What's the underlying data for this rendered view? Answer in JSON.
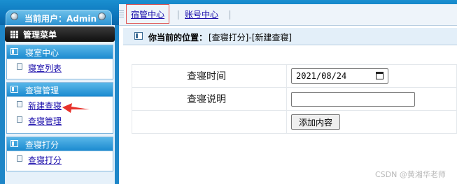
{
  "header": {
    "current_user": "当前用户：Admin"
  },
  "top_nav": {
    "tabs": [
      {
        "label": "宿管中心"
      },
      {
        "label": "账号中心"
      }
    ]
  },
  "sidebar": {
    "menu_title": "管理菜单",
    "groups": [
      {
        "title": "寝室中心",
        "items": [
          {
            "label": "寝室列表"
          }
        ]
      },
      {
        "title": "查寝管理",
        "items": [
          {
            "label": "新建查寝"
          },
          {
            "label": "查寝管理"
          }
        ]
      },
      {
        "title": "查寝打分",
        "items": [
          {
            "label": "查寝打分"
          }
        ]
      }
    ]
  },
  "breadcrumb": {
    "prefix": "你当前的位置：",
    "path": "[查寝打分]-[新建查寝]"
  },
  "form": {
    "date_label": "查寝时间",
    "date_value": "2021/08/24",
    "desc_label": "查寝说明",
    "desc_value": "",
    "submit_label": "添加内容"
  },
  "watermark": "CSDN @黄湘华老师",
  "colors": {
    "accent_blue": "#1e86c8",
    "highlight_red": "#e05555"
  },
  "icons": {
    "menu": "grid-icon",
    "group": "list-icon",
    "item": "document-icon",
    "date": "calendar-icon"
  }
}
